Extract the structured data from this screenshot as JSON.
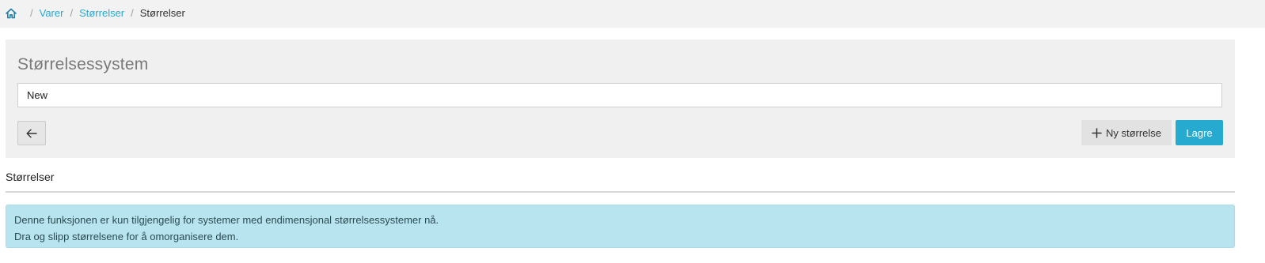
{
  "breadcrumb": {
    "home_icon": "home-icon",
    "items": [
      {
        "label": "Varer"
      },
      {
        "label": "Størrelser"
      }
    ],
    "current": "Størrelser",
    "separator": "/"
  },
  "panel": {
    "title": "Størrelsessystem",
    "name_value": "New",
    "back_icon": "arrow-left-icon",
    "new_size_label": "Ny størrelse",
    "new_size_icon": "plus-icon",
    "save_label": "Lagre"
  },
  "sizes_section": {
    "title": "Størrelser"
  },
  "info": {
    "line1": "Denne funksjonen er kun tilgjengelig for systemer med endimensjonal størrelsessystemer nå.",
    "line2": "Dra og slipp størrelsene for å omorganisere dem."
  },
  "colors": {
    "accent": "#27aad0",
    "link": "#2aa9d2",
    "info_bg": "#b7e4ef"
  }
}
